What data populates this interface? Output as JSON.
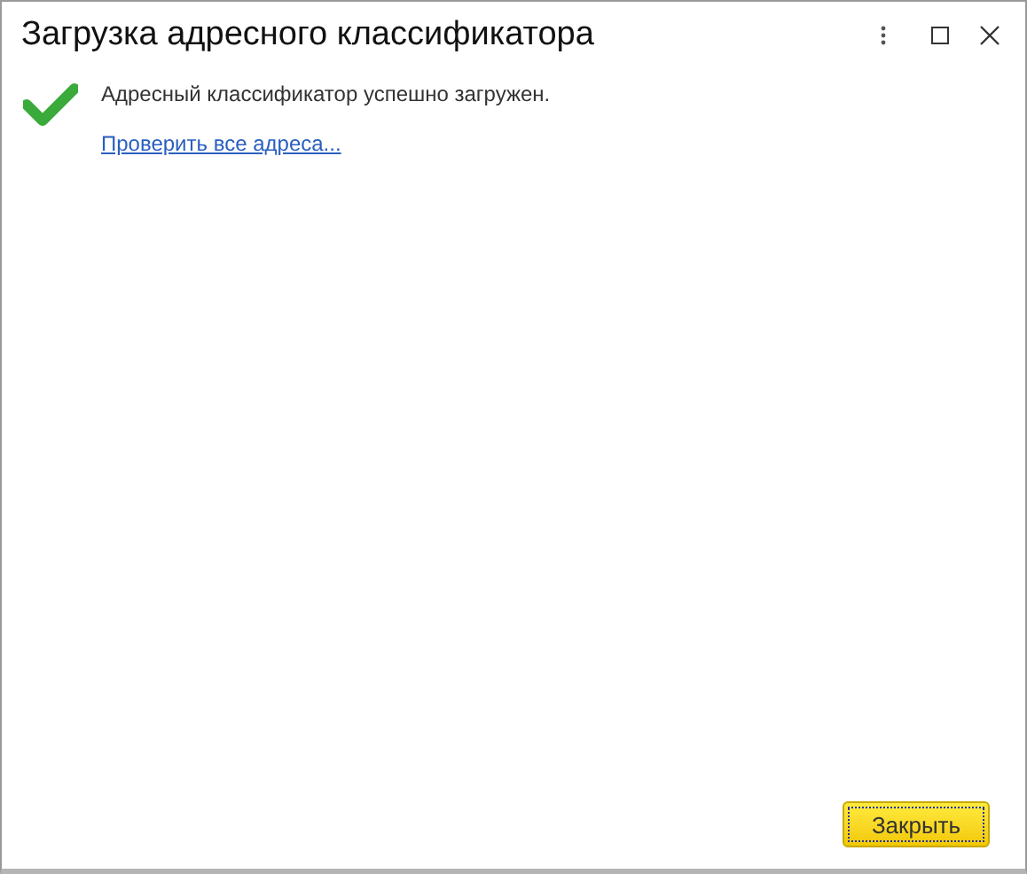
{
  "window": {
    "title": "Загрузка адресного классификатора"
  },
  "message": "Адресный классификатор успешно загружен.",
  "link": "Проверить все адреса...",
  "buttons": [
    {
      "label": "Закрыть",
      "default": true
    }
  ]
}
